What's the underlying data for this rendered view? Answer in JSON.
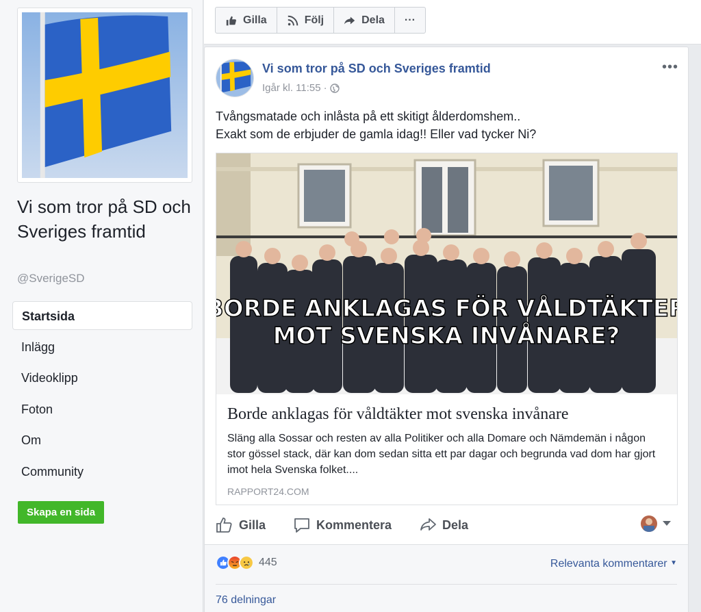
{
  "page": {
    "name": "Vi som tror på SD och Sveriges framtid",
    "handle": "@SverigeSD"
  },
  "nav": [
    {
      "label": "Startsida"
    },
    {
      "label": "Inlägg"
    },
    {
      "label": "Videoklipp"
    },
    {
      "label": "Foton"
    },
    {
      "label": "Om"
    },
    {
      "label": "Community"
    }
  ],
  "create_page_label": "Skapa en sida",
  "top_actions": {
    "like": "Gilla",
    "follow": "Följ",
    "share": "Dela",
    "more": "···"
  },
  "post": {
    "author": "Vi som tror på SD och Sveriges framtid",
    "time": "Igår kl. 11:55",
    "separator": "·",
    "text_line1": "Tvångsmatade och inlåsta på ett skitigt ålderdomshem..",
    "text_line2": "Exakt som de erbjuder de gamla idag!! Eller vad tycker Ni?",
    "image_overlay_line1": "BORDE ANKLAGAS FÖR VÅLDTÄKTER",
    "image_overlay_line2": "MOT SVENSKA INVÅNARE?",
    "link_title": "Borde anklagas för våldtäkter mot svenska invånare",
    "link_description": "Släng alla Sossar och resten av alla Politiker och alla Domare och Nämdemän i någon stor gössel stack, där kan dom sedan sitta ett par dagar och begrunda vad dom har gjort imot hela Svenska folket....",
    "link_domain": "RAPPORT24.COM",
    "actions": {
      "like": "Gilla",
      "comment": "Kommentera",
      "share": "Dela"
    },
    "reaction_count": "445",
    "relevant_comments": "Relevanta kommentarer",
    "shares": "76 delningar"
  },
  "colors": {
    "link_blue": "#365899",
    "green_button": "#42b72a",
    "flag_blue": "#2b62c6",
    "flag_yellow": "#fecc00"
  }
}
